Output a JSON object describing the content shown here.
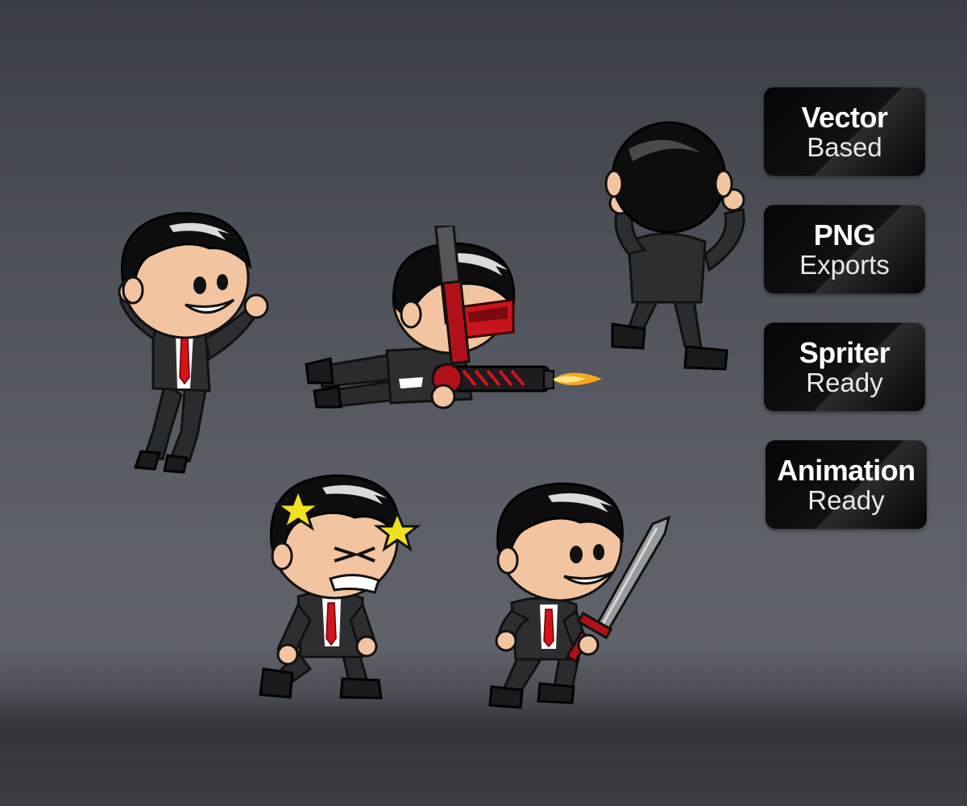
{
  "badges": [
    {
      "title": "Vector",
      "subtitle": "Based"
    },
    {
      "title": "PNG",
      "subtitle": "Exports"
    },
    {
      "title": "Spriter",
      "subtitle": "Ready"
    },
    {
      "title": "Animation",
      "subtitle": "Ready"
    }
  ],
  "sprites": [
    {
      "pose": "jumping"
    },
    {
      "pose": "flying-shooting"
    },
    {
      "pose": "back-view"
    },
    {
      "pose": "stunned"
    },
    {
      "pose": "sword-walking"
    }
  ],
  "colors": {
    "suit": "#2e2e30",
    "suit_shade": "#1e1e20",
    "tie": "#d2141b",
    "skin": "#f2c5a0",
    "hair": "#0d0d0d",
    "star": "#f0e020",
    "badge_bg": "#0a0a0a"
  }
}
